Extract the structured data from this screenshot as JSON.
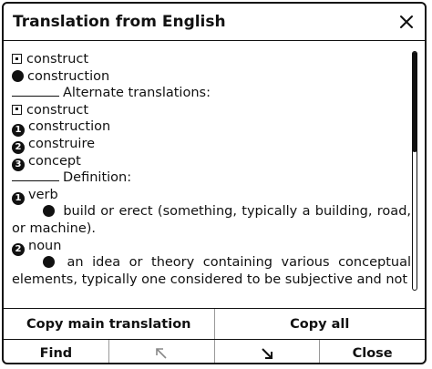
{
  "dialog": {
    "title": "Translation from English"
  },
  "content": {
    "main_translations": [
      {
        "marker": "square",
        "text": "construct"
      },
      {
        "marker": "dot",
        "text": "construction"
      }
    ],
    "alternate_heading": "Alternate translations:",
    "alternate_translations": [
      {
        "marker": "square",
        "text": "construct"
      },
      {
        "marker": "1",
        "text": "construction"
      },
      {
        "marker": "2",
        "text": "construire"
      },
      {
        "marker": "3",
        "text": "concept"
      }
    ],
    "definition_heading": "Definition:",
    "definitions": [
      {
        "number": "1",
        "pos": "verb",
        "meaning": "build or erect (something, typically a building, road, or machine)."
      },
      {
        "number": "2",
        "pos": "noun",
        "meaning": "an idea or theory containing various conceptual elements, typically one considered to be subjective and not"
      }
    ]
  },
  "scrollbar": {
    "position": 0.0,
    "visible_fraction": 0.42
  },
  "buttons": {
    "copy_main": "Copy main translation",
    "copy_all": "Copy all",
    "find": "Find",
    "close": "Close"
  },
  "icons": {
    "close": "close-icon",
    "arrow_prev": "arrow-up-left-icon",
    "arrow_next": "arrow-down-right-icon"
  },
  "colors": {
    "foreground": "#111111",
    "background": "#ffffff",
    "disabled": "#888888"
  }
}
